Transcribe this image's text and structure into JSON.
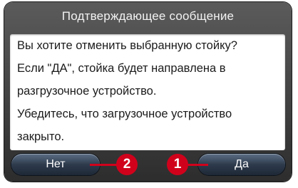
{
  "dialog": {
    "title": "Подтверждающее сообщение",
    "message_lines": [
      "Вы хотите отменить выбранную стойку?",
      "Если \"ДА\", стойка будет направлена в",
      "разгрузочное устройство.",
      "Убедитесь, что загрузочное устройство",
      "закрыто."
    ],
    "buttons": {
      "no_label": "Нет",
      "yes_label": "Да"
    }
  },
  "callouts": {
    "yes_number": "1",
    "no_number": "2"
  },
  "colors": {
    "frame": "#3a3a3a",
    "button": "#2e3b4d",
    "callout": "#d0021b"
  }
}
